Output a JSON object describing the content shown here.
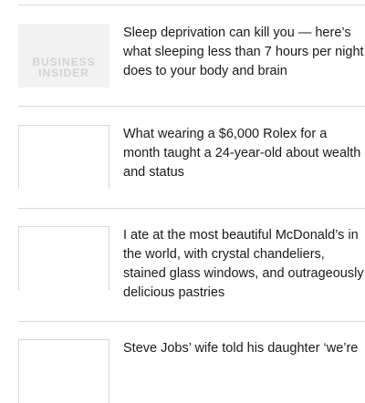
{
  "articles": [
    {
      "thumbnail": {
        "type": "logo",
        "logo_line1": "BUSINESS",
        "logo_line2": "INSIDER"
      },
      "headline": "Sleep deprivation can kill you — here’s what sleeping less than 7 hours per night does to your body and brain"
    },
    {
      "thumbnail": {
        "type": "blank"
      },
      "headline": "What wearing a $6,000 Rolex for a month taught a 24-year-old about wealth and status"
    },
    {
      "thumbnail": {
        "type": "blank"
      },
      "headline": "I ate at the most beautiful McDonald’s in the world, with crystal chandeliers, stained glass windows, and outrageously delicious pastries"
    },
    {
      "thumbnail": {
        "type": "blank"
      },
      "headline": "Steve Jobs’ wife told his daughter ‘we’re"
    }
  ]
}
